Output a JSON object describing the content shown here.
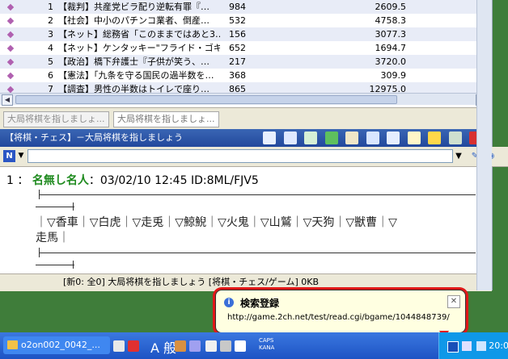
{
  "thread_list": {
    "rows": [
      {
        "no": "1",
        "title": "【裁判】共産党ビラ配り逆転有罪『…",
        "count": "984",
        "speed": "2609.5"
      },
      {
        "no": "2",
        "title": "【社会】中小のパチンコ業者、倒産…",
        "count": "532",
        "speed": "4758.3"
      },
      {
        "no": "3",
        "title": "【ネット】総務省「このままではあと3…",
        "count": "156",
        "speed": "3077.3"
      },
      {
        "no": "4",
        "title": "【ネット】ケンタッキー\"フライド・ゴキ…",
        "count": "652",
        "speed": "1694.7"
      },
      {
        "no": "5",
        "title": "【政治】橋下弁護士『子供が笑う、…",
        "count": "217",
        "speed": "3720.0"
      },
      {
        "no": "6",
        "title": "【憲法】「九条を守る国民の過半数を…",
        "count": "368",
        "speed": "309.9"
      },
      {
        "no": "7",
        "title": "【調査】男性の半数はトイレで座り…",
        "count": "865",
        "speed": "12975.0"
      }
    ]
  },
  "tabs": [
    "大局将棋を指しましょ...",
    "大局将棋を指しましょ..."
  ],
  "title_bar": {
    "text": "【将棋・チェス】－大局将棋を指しましょう"
  },
  "address_bar": {
    "value": ""
  },
  "message": {
    "number": "1",
    "name": "名無し名人",
    "meta": "：03/02/10 12:45 ID:8ML/FJV5",
    "line1": "｜▽香車｜▽白虎｜▽走兎｜▽鯨鯢｜▽火鬼｜▽山鷲｜▽天狗｜▽獣曹｜▽",
    "line2": "走馬｜"
  },
  "status_bar": {
    "text": "[新0: 全0] 大局将棋を指しましょう [将棋・チェス/ゲーム] 0KB"
  },
  "balloon": {
    "title": "検索登録",
    "url": "http://game.2ch.net/test/read.cgi/bgame/1044848739/",
    "close": "✕"
  },
  "taskbar": {
    "task_label": "o2on002_0042_...",
    "ime_label": "A 般",
    "caps": "CAPS",
    "kana": "KANA",
    "clock": "20:0"
  }
}
